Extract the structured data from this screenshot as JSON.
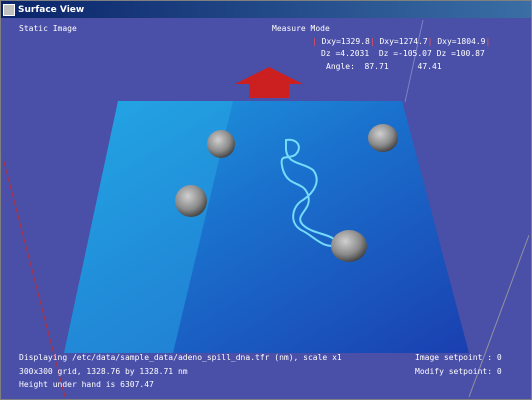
{
  "window": {
    "title": "Surface View"
  },
  "hud": {
    "static_image": "Static Image",
    "measure_mode": "Measure Mode",
    "dxy": [
      "Dxy=1329.8",
      "Dxy=1274.7",
      "Dxy=1804.9"
    ],
    "dz": [
      "Dz =4.2031",
      "Dz =-105.07",
      "Dz =100.87"
    ],
    "angle_label": "Angle:",
    "angle_values": [
      "87.71",
      "47.41"
    ],
    "displaying": "Displaying /etc/data/sample_data/adeno_spill_dna.tfr (nm), scale x1",
    "grid": "300x300 grid, 1328.76 by 1328.71 nm",
    "height": "Height under hand is 6307.47",
    "image_setpoint": "Image setpoint : 0",
    "modify_setpoint": "Modify setpoint: 0"
  },
  "colors": {
    "background": "#4a4fa8",
    "surface": "#1f8fd8",
    "arrow": "#cc2020",
    "dna": "#7fe8ff",
    "blob": "#8c8c8c",
    "text": "#ffffff"
  },
  "icons": {
    "window_icon": "window-icon",
    "arrow": "up-arrow-icon"
  }
}
